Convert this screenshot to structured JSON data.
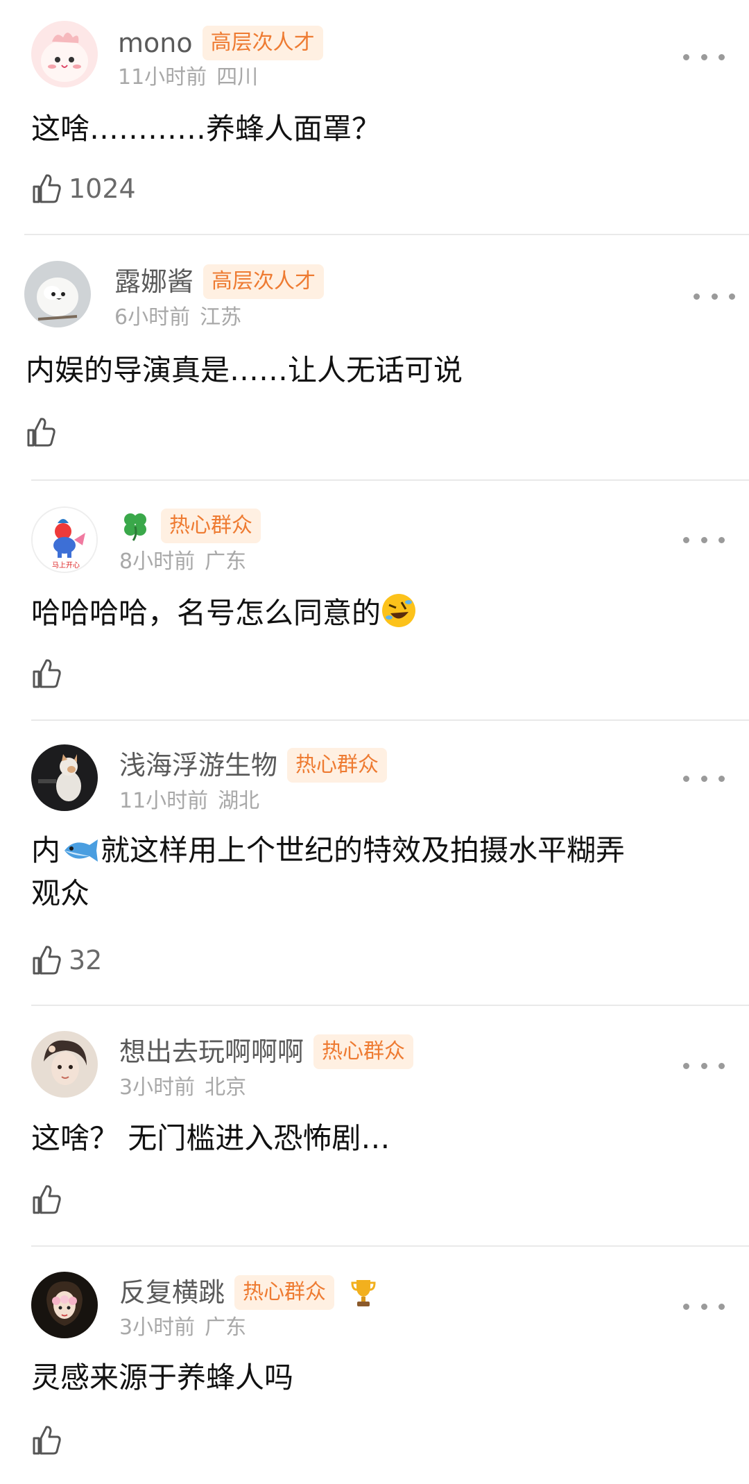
{
  "comments": [
    {
      "username": "mono",
      "badge": "高层次人才",
      "time": "11小时前",
      "location": "四川",
      "text": "这啥…………养蜂人面罩？",
      "likes": "1024"
    },
    {
      "username": "露娜酱",
      "badge": "高层次人才",
      "time": "6小时前",
      "location": "江苏",
      "text": "内娱的导演真是……让人无话可说",
      "likes": ""
    },
    {
      "username": "",
      "badge": "热心群众",
      "time": "8小时前",
      "location": "广东",
      "text": "哈哈哈哈，名号怎么同意的",
      "emoji": "rolling-laughing-emoji",
      "likes": "",
      "avatar_text": "马上开心"
    },
    {
      "username": "浅海浮游生物",
      "badge": "热心群众",
      "time": "11小时前",
      "location": "湖北",
      "text_before": "内",
      "text_after": "就这样用上个世纪的特效及拍摄水平糊弄",
      "text_line2": "观众",
      "emoji": "fish-emoji",
      "likes": "32"
    },
    {
      "username": "想出去玩啊啊啊",
      "badge": "热心群众",
      "time": "3小时前",
      "location": "北京",
      "text": "这啥？ 无门槛进入恐怖剧…",
      "likes": ""
    },
    {
      "username": "反复横跳",
      "badge": "热心群众",
      "time": "3小时前",
      "location": "广东",
      "text": "灵感来源于养蜂人吗",
      "likes": ""
    }
  ],
  "colors": {
    "badge_text": "#ee7b32",
    "badge_bg": "#fff0e2",
    "meta_text": "#a8a8a8",
    "username_text": "#5a5a5a"
  },
  "icons": {
    "like": "thumbs-up-icon",
    "more": "more-dots-icon",
    "clover": "four-leaf-clover-icon",
    "trophy": "trophy-icon"
  }
}
